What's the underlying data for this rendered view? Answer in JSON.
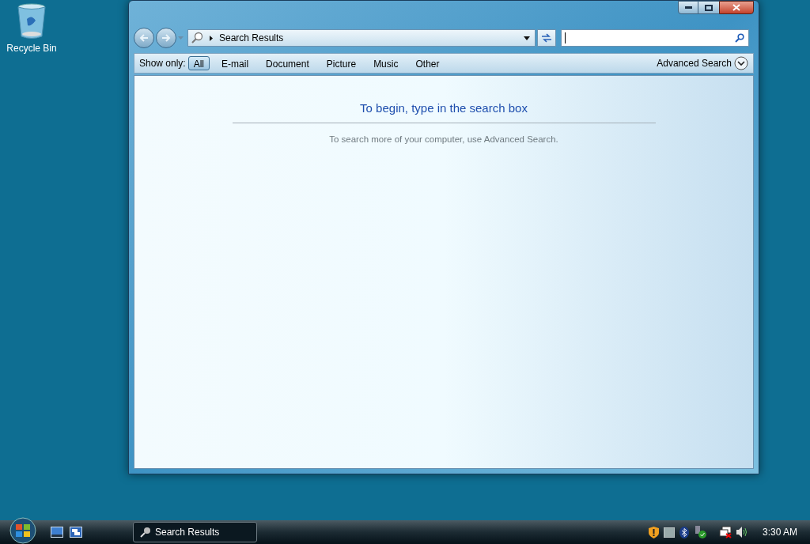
{
  "desktop_icons": [
    {
      "label": "Recycle Bin"
    }
  ],
  "window": {
    "address": "Search Results",
    "filter_bar": {
      "label": "Show only:",
      "filters": [
        {
          "label": "All",
          "selected": true
        },
        {
          "label": "E-mail",
          "selected": false
        },
        {
          "label": "Document",
          "selected": false
        },
        {
          "label": "Picture",
          "selected": false
        },
        {
          "label": "Music",
          "selected": false
        },
        {
          "label": "Other",
          "selected": false
        }
      ],
      "advanced": "Advanced Search"
    },
    "content": {
      "heading": "To begin, type in the search box",
      "hint": "To search more of your computer, use Advanced Search."
    }
  },
  "taskbar": {
    "tasks": [
      {
        "label": "Search Results",
        "selected": false
      }
    ],
    "clock": "3:30 AM"
  }
}
